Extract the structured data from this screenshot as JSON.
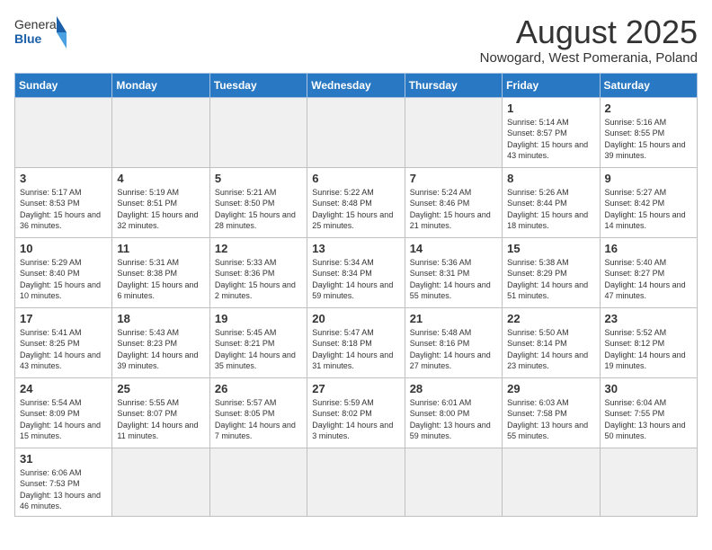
{
  "header": {
    "logo_general": "General",
    "logo_blue": "Blue",
    "title": "August 2025",
    "subtitle": "Nowogard, West Pomerania, Poland"
  },
  "weekdays": [
    "Sunday",
    "Monday",
    "Tuesday",
    "Wednesday",
    "Thursday",
    "Friday",
    "Saturday"
  ],
  "weeks": [
    [
      {
        "day": "",
        "info": ""
      },
      {
        "day": "",
        "info": ""
      },
      {
        "day": "",
        "info": ""
      },
      {
        "day": "",
        "info": ""
      },
      {
        "day": "",
        "info": ""
      },
      {
        "day": "1",
        "info": "Sunrise: 5:14 AM\nSunset: 8:57 PM\nDaylight: 15 hours\nand 43 minutes."
      },
      {
        "day": "2",
        "info": "Sunrise: 5:16 AM\nSunset: 8:55 PM\nDaylight: 15 hours\nand 39 minutes."
      }
    ],
    [
      {
        "day": "3",
        "info": "Sunrise: 5:17 AM\nSunset: 8:53 PM\nDaylight: 15 hours\nand 36 minutes."
      },
      {
        "day": "4",
        "info": "Sunrise: 5:19 AM\nSunset: 8:51 PM\nDaylight: 15 hours\nand 32 minutes."
      },
      {
        "day": "5",
        "info": "Sunrise: 5:21 AM\nSunset: 8:50 PM\nDaylight: 15 hours\nand 28 minutes."
      },
      {
        "day": "6",
        "info": "Sunrise: 5:22 AM\nSunset: 8:48 PM\nDaylight: 15 hours\nand 25 minutes."
      },
      {
        "day": "7",
        "info": "Sunrise: 5:24 AM\nSunset: 8:46 PM\nDaylight: 15 hours\nand 21 minutes."
      },
      {
        "day": "8",
        "info": "Sunrise: 5:26 AM\nSunset: 8:44 PM\nDaylight: 15 hours\nand 18 minutes."
      },
      {
        "day": "9",
        "info": "Sunrise: 5:27 AM\nSunset: 8:42 PM\nDaylight: 15 hours\nand 14 minutes."
      }
    ],
    [
      {
        "day": "10",
        "info": "Sunrise: 5:29 AM\nSunset: 8:40 PM\nDaylight: 15 hours\nand 10 minutes."
      },
      {
        "day": "11",
        "info": "Sunrise: 5:31 AM\nSunset: 8:38 PM\nDaylight: 15 hours\nand 6 minutes."
      },
      {
        "day": "12",
        "info": "Sunrise: 5:33 AM\nSunset: 8:36 PM\nDaylight: 15 hours\nand 2 minutes."
      },
      {
        "day": "13",
        "info": "Sunrise: 5:34 AM\nSunset: 8:34 PM\nDaylight: 14 hours\nand 59 minutes."
      },
      {
        "day": "14",
        "info": "Sunrise: 5:36 AM\nSunset: 8:31 PM\nDaylight: 14 hours\nand 55 minutes."
      },
      {
        "day": "15",
        "info": "Sunrise: 5:38 AM\nSunset: 8:29 PM\nDaylight: 14 hours\nand 51 minutes."
      },
      {
        "day": "16",
        "info": "Sunrise: 5:40 AM\nSunset: 8:27 PM\nDaylight: 14 hours\nand 47 minutes."
      }
    ],
    [
      {
        "day": "17",
        "info": "Sunrise: 5:41 AM\nSunset: 8:25 PM\nDaylight: 14 hours\nand 43 minutes."
      },
      {
        "day": "18",
        "info": "Sunrise: 5:43 AM\nSunset: 8:23 PM\nDaylight: 14 hours\nand 39 minutes."
      },
      {
        "day": "19",
        "info": "Sunrise: 5:45 AM\nSunset: 8:21 PM\nDaylight: 14 hours\nand 35 minutes."
      },
      {
        "day": "20",
        "info": "Sunrise: 5:47 AM\nSunset: 8:18 PM\nDaylight: 14 hours\nand 31 minutes."
      },
      {
        "day": "21",
        "info": "Sunrise: 5:48 AM\nSunset: 8:16 PM\nDaylight: 14 hours\nand 27 minutes."
      },
      {
        "day": "22",
        "info": "Sunrise: 5:50 AM\nSunset: 8:14 PM\nDaylight: 14 hours\nand 23 minutes."
      },
      {
        "day": "23",
        "info": "Sunrise: 5:52 AM\nSunset: 8:12 PM\nDaylight: 14 hours\nand 19 minutes."
      }
    ],
    [
      {
        "day": "24",
        "info": "Sunrise: 5:54 AM\nSunset: 8:09 PM\nDaylight: 14 hours\nand 15 minutes."
      },
      {
        "day": "25",
        "info": "Sunrise: 5:55 AM\nSunset: 8:07 PM\nDaylight: 14 hours\nand 11 minutes."
      },
      {
        "day": "26",
        "info": "Sunrise: 5:57 AM\nSunset: 8:05 PM\nDaylight: 14 hours\nand 7 minutes."
      },
      {
        "day": "27",
        "info": "Sunrise: 5:59 AM\nSunset: 8:02 PM\nDaylight: 14 hours\nand 3 minutes."
      },
      {
        "day": "28",
        "info": "Sunrise: 6:01 AM\nSunset: 8:00 PM\nDaylight: 13 hours\nand 59 minutes."
      },
      {
        "day": "29",
        "info": "Sunrise: 6:03 AM\nSunset: 7:58 PM\nDaylight: 13 hours\nand 55 minutes."
      },
      {
        "day": "30",
        "info": "Sunrise: 6:04 AM\nSunset: 7:55 PM\nDaylight: 13 hours\nand 50 minutes."
      }
    ],
    [
      {
        "day": "31",
        "info": "Sunrise: 6:06 AM\nSunset: 7:53 PM\nDaylight: 13 hours\nand 46 minutes."
      },
      {
        "day": "",
        "info": ""
      },
      {
        "day": "",
        "info": ""
      },
      {
        "day": "",
        "info": ""
      },
      {
        "day": "",
        "info": ""
      },
      {
        "day": "",
        "info": ""
      },
      {
        "day": "",
        "info": ""
      }
    ]
  ]
}
